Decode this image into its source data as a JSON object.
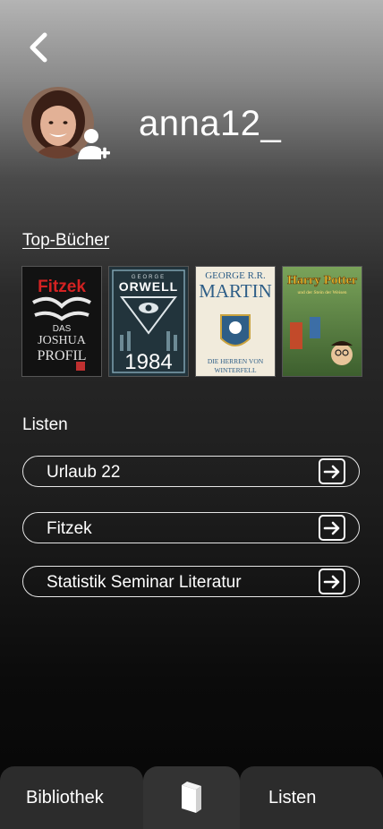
{
  "profile": {
    "username": "anna12_"
  },
  "sections": {
    "top_books": "Top-Bücher",
    "lists": "Listen"
  },
  "books": [
    {
      "top": "Fitzek",
      "mid": "DAS",
      "mid2": "JOSHUA",
      "bottom": "PROFIL"
    },
    {
      "top": "GEORGE",
      "mid": "ORWELL",
      "bottom": "1984"
    },
    {
      "top": "GEORGE R.R.",
      "mid": "MARTIN",
      "bottom": "DIE HERREN VON",
      "bottom2": "WINTERFELL"
    },
    {
      "top": "Harry Potter",
      "mid": "und der Stein der Weisen"
    }
  ],
  "lists": [
    {
      "label": "Urlaub 22"
    },
    {
      "label": "Fitzek"
    },
    {
      "label": "Statistik Seminar Literatur"
    }
  ],
  "tabbar": {
    "left": "Bibliothek",
    "right": "Listen"
  },
  "icons": {
    "back": "chevron-left-icon",
    "add_user": "user-plus-icon",
    "arrow": "arrow-right-box-icon",
    "book": "book-icon"
  }
}
